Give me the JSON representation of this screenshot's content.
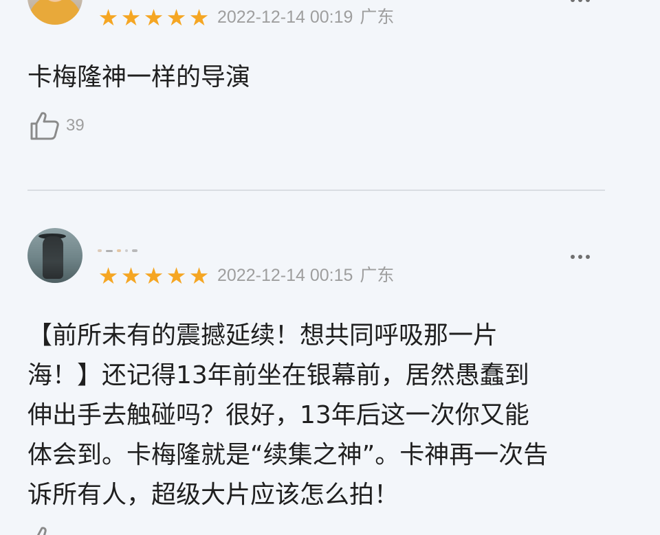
{
  "comments": [
    {
      "rating": 5,
      "date": "2022-12-14 00:19",
      "location": "广东",
      "text": "卡梅隆神一样的导演",
      "likes": "39"
    },
    {
      "rating": 5,
      "date": "2022-12-14 00:15",
      "location": "广东",
      "text_lines": [
        "【前所未有的震撼延续！想共同呼吸那一片",
        "海！】还记得13年前坐在银幕前，居然愚蠢到",
        "伸出手去触碰吗？很好，13年后这一次你又能",
        "体会到。卡梅隆就是“续集之神”。卡神再一次告",
        "诉所有人，超级大片应该怎么拍！"
      ]
    }
  ],
  "colors": {
    "star": "#f5a623",
    "meta_text": "#9e9e9e",
    "body_text": "#1f1f1f",
    "background": "#f3f6fa"
  },
  "icons": {
    "rating": "star-icon",
    "like": "thumbs-up-icon",
    "more": "more-options-icon"
  }
}
